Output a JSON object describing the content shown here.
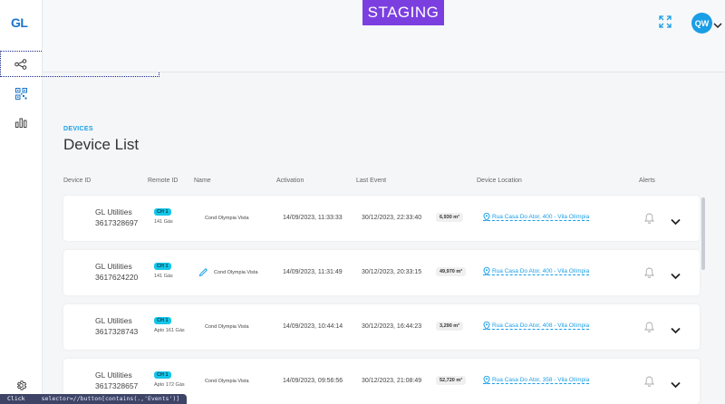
{
  "app": {
    "logo": "GL",
    "environment_badge": "STAGING"
  },
  "header": {
    "avatar_initials": "QW"
  },
  "sidebar": {
    "items": [
      {
        "icon": "network-nodes-icon"
      },
      {
        "icon": "qr-code-icon"
      },
      {
        "icon": "bar-chart-icon"
      }
    ],
    "footer_icon": "gear-icon"
  },
  "page": {
    "section": "DEVICES",
    "title": "Device List"
  },
  "table": {
    "columns": {
      "device_id": "Device ID",
      "remote_id": "Remote ID",
      "name": "Name",
      "activation": "Activation",
      "last_event": "Last Event",
      "device_location": "Device Location",
      "alerts": "Alerts"
    },
    "rows": [
      {
        "company": "GL Utilities",
        "device_id": "3617328697",
        "channel": "CH 1",
        "remote_sub": "141 Gás",
        "name": "Cond Olympia Vista",
        "activation": "14/09/2023, 11:33:33",
        "last_event": "30/12/2023, 22:33:40",
        "reading": "6,930 m³",
        "location": "Rua Casa Do Ator, 400 - Vila Olímpia",
        "editable": false
      },
      {
        "company": "GL Utilities",
        "device_id": "3617624220",
        "channel": "CH 1",
        "remote_sub": "141 Gás",
        "name": "Cond Olympia Vista",
        "activation": "14/09/2023, 11:31:49",
        "last_event": "30/12/2023, 20:33:15",
        "reading": "49,970 m³",
        "location": "Rua Casa Do Ator, 400 - Vila Olímpia",
        "editable": true
      },
      {
        "company": "GL Utilities",
        "device_id": "3617328743",
        "channel": "CH 1",
        "remote_sub": "Apto 161 Gás",
        "name": "Cond Olympia Vista",
        "activation": "14/09/2023, 10:44:14",
        "last_event": "30/12/2023, 16:44:23",
        "reading": "3,290 m³",
        "location": "Rua Casa Do Ator, 408 - Vila Olímpia",
        "editable": false
      },
      {
        "company": "GL Utilities",
        "device_id": "3617328657",
        "channel": "CH 1",
        "remote_sub": "Apto 172 Gás",
        "name": "Cond Olympia Vista",
        "activation": "14/09/2023, 09:56:56",
        "last_event": "30/12/2023, 21:08:49",
        "reading": "52,720 m³",
        "location": "Rua Casa Do Ator, 358 - Vila Olímpia",
        "editable": false
      }
    ]
  },
  "status_bar": {
    "action": "Click",
    "selector": "selector=//button[contains(.,'Events')]"
  }
}
